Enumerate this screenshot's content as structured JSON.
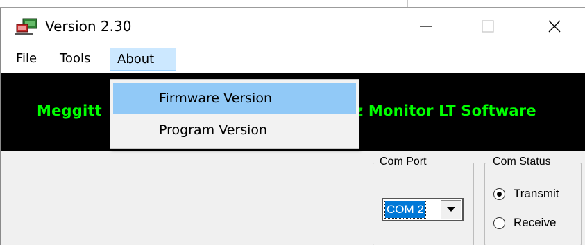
{
  "window": {
    "title": "Version 2.30"
  },
  "menubar": {
    "file": "File",
    "tools": "Tools",
    "about": "About"
  },
  "about_menu": {
    "items": [
      {
        "label": "Firmware Version",
        "highlighted": true
      },
      {
        "label": "Program Version",
        "highlighted": false
      }
    ]
  },
  "banner": {
    "text_left": "Meggitt",
    "text_right": "z Monitor LT Software",
    "text_color": "#00ff00",
    "background": "#000000"
  },
  "com_port": {
    "group_label": "Com Port",
    "selected": "COM 2"
  },
  "com_status": {
    "group_label": "Com Status",
    "options": [
      {
        "label": "Transmit",
        "checked": true
      },
      {
        "label": "Receive",
        "checked": false
      }
    ]
  },
  "colors": {
    "menu_highlight": "#91c9f7",
    "about_active": "#cce8ff",
    "selection": "#0078d7",
    "panel": "#f0f0f0"
  }
}
